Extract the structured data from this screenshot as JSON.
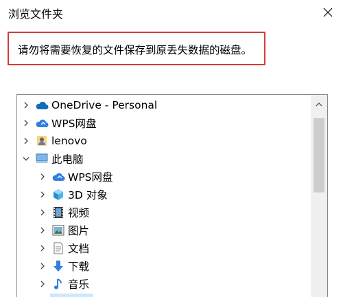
{
  "window": {
    "title": "浏览文件夹",
    "close_icon": "close-icon"
  },
  "message": {
    "text": "请勿将需要恢复的文件保存到原丢失数据的磁盘。",
    "border_color": "#d43b3b"
  },
  "tree": {
    "items": [
      {
        "label": "OneDrive - Personal",
        "icon": "cloud-icon",
        "expanded": false,
        "level": 0
      },
      {
        "label": "WPS网盘",
        "icon": "wps-cloud-icon",
        "expanded": false,
        "level": 0
      },
      {
        "label": "lenovo",
        "icon": "user-folder-icon",
        "expanded": false,
        "level": 0
      },
      {
        "label": "此电脑",
        "icon": "computer-icon",
        "expanded": true,
        "level": 0
      },
      {
        "label": "WPS网盘",
        "icon": "wps-cloud-icon",
        "expanded": false,
        "level": 1
      },
      {
        "label": "3D 对象",
        "icon": "3d-objects-icon",
        "expanded": false,
        "level": 1
      },
      {
        "label": "视频",
        "icon": "video-icon",
        "expanded": false,
        "level": 1
      },
      {
        "label": "图片",
        "icon": "pictures-icon",
        "expanded": false,
        "level": 1
      },
      {
        "label": "文档",
        "icon": "documents-icon",
        "expanded": false,
        "level": 1
      },
      {
        "label": "下载",
        "icon": "downloads-icon",
        "expanded": false,
        "level": 1
      },
      {
        "label": "音乐",
        "icon": "music-icon",
        "expanded": false,
        "level": 1
      }
    ],
    "selection_color": "#cce8ff"
  },
  "scrollbar": {
    "up_icon": "chevron-up-icon"
  }
}
